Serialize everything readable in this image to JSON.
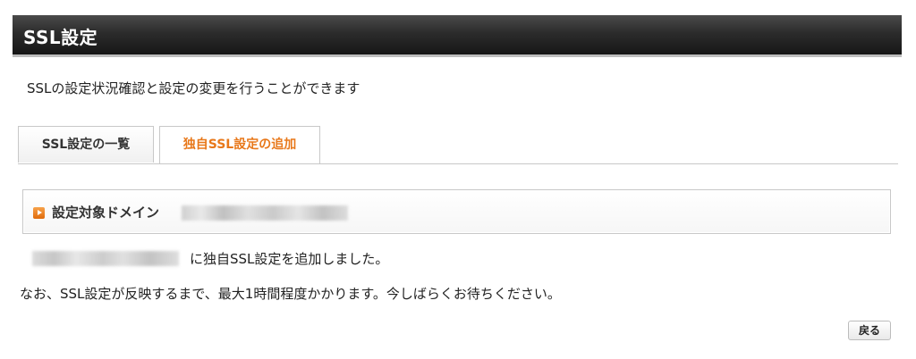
{
  "header": {
    "title": "SSL設定"
  },
  "description": "SSLの設定状況確認と設定の変更を行うことができます",
  "tabs": [
    {
      "label": "SSL設定の一覧",
      "active": false
    },
    {
      "label": "独自SSL設定の追加",
      "active": true
    }
  ],
  "domain_section": {
    "icon": "orange-arrow-icon",
    "label": "設定対象ドメイン"
  },
  "result_message": "に独自SSL設定を追加しました。",
  "notice": "なお、SSL設定が反映するまで、最大1時間程度かかります。今しばらくお待ちください。",
  "back_button": {
    "label": "戻る"
  },
  "colors": {
    "active_tab": "#e8781a",
    "header_bg": "#222222",
    "icon_orange": "#f08a24"
  }
}
